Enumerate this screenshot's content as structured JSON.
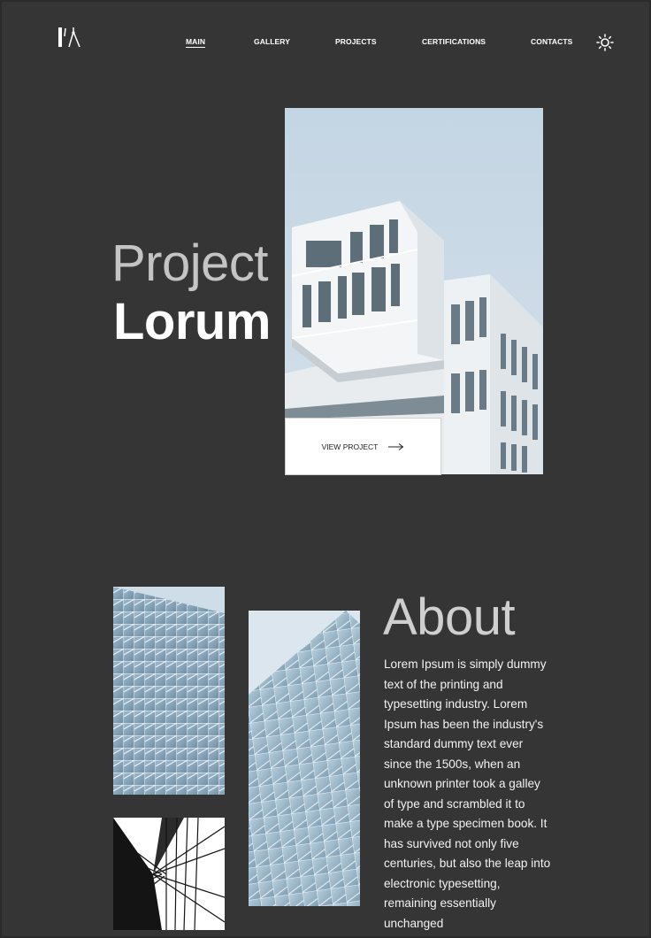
{
  "header": {
    "logo_icon": "architect-compass-logo-icon",
    "nav": [
      {
        "label": "MAIN",
        "active": true
      },
      {
        "label": "GALLERY",
        "active": false
      },
      {
        "label": "PROJECTS",
        "active": false
      },
      {
        "label": "CERTIFICATIONS",
        "active": false
      },
      {
        "label": "CONTACTS",
        "active": false
      }
    ],
    "theme_toggle_icon": "sun-icon"
  },
  "hero": {
    "title_light": "Project",
    "title_bold": "Lorum",
    "image_icon": "white-building-photo",
    "cta_label": "VIEW PROJECT",
    "cta_icon": "arrow-right-icon"
  },
  "about": {
    "title": "About",
    "text": "Lorem Ipsum is simply dummy text of the printing and typesetting industry. Lorem Ipsum has been the industry's standard dummy text ever since the 1500s, when an unknown printer took a galley of type and scrambled it to make a type specimen book. It has survived not only five centuries, but also the leap into electronic typesetting, remaining essentially unchanged",
    "images": [
      "glass-facade-photo",
      "glass-tower-photo",
      "bw-skyscraper-photo"
    ]
  },
  "colors": {
    "background": "#353535",
    "text": "#ffffff",
    "muted_heading": "#c4c4c4",
    "sky": "#c8d8e4"
  }
}
